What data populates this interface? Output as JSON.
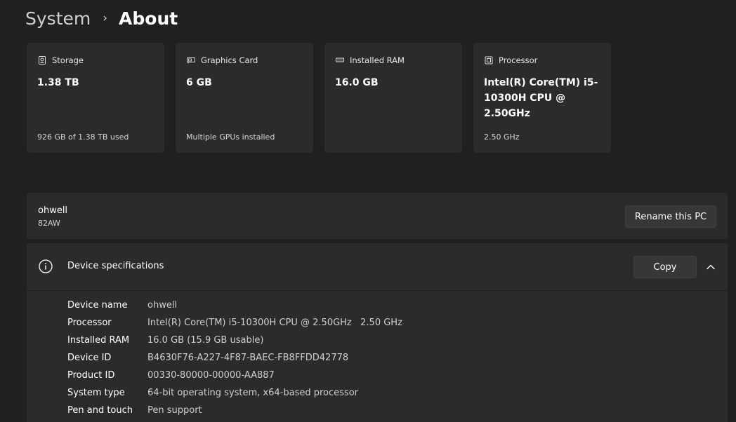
{
  "breadcrumb": {
    "parent": "System",
    "separator": "›",
    "current": "About"
  },
  "cards": [
    {
      "icon": "storage-icon",
      "title": "Storage",
      "value": "1.38 TB",
      "sub": "926 GB of 1.38 TB used"
    },
    {
      "icon": "graphics-card-icon",
      "title": "Graphics Card",
      "value": "6 GB",
      "sub": "Multiple GPUs installed"
    },
    {
      "icon": "ram-icon",
      "title": "Installed RAM",
      "value": "16.0 GB",
      "sub": ""
    },
    {
      "icon": "processor-icon",
      "title": "Processor",
      "value": "Intel(R) Core(TM) i5-10300H CPU @ 2.50GHz",
      "sub": "2.50 GHz"
    }
  ],
  "pc": {
    "name": "ohwell",
    "model": "82AW",
    "rename_label": "Rename this PC"
  },
  "specs": {
    "title": "Device specifications",
    "copy_label": "Copy",
    "rows": [
      {
        "label": "Device name",
        "value": "ohwell"
      },
      {
        "label": "Processor",
        "value": "Intel(R) Core(TM) i5-10300H CPU @ 2.50GHz   2.50 GHz"
      },
      {
        "label": "Installed RAM",
        "value": "16.0 GB (15.9 GB usable)"
      },
      {
        "label": "Device ID",
        "value": "B4630F76-A227-4F87-BAEC-FB8FFDD42778"
      },
      {
        "label": "Product ID",
        "value": "00330-80000-00000-AA887"
      },
      {
        "label": "System type",
        "value": "64-bit operating system, x64-based processor"
      },
      {
        "label": "Pen and touch",
        "value": "Pen support"
      }
    ]
  },
  "colors": {
    "background": "#202020",
    "card": "#2b2b2b",
    "button": "#373737",
    "text": "#ffffff",
    "secondary_text": "#cfcfcf"
  }
}
